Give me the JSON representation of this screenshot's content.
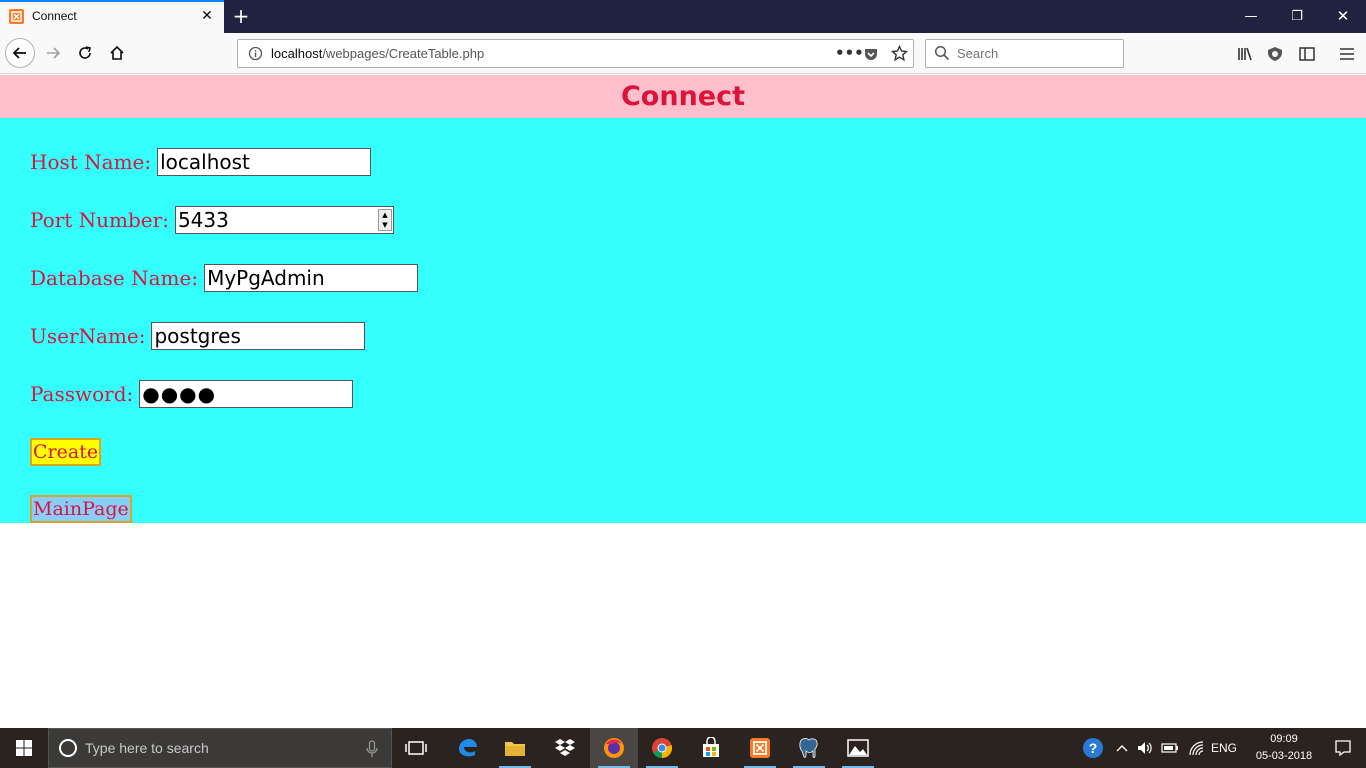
{
  "browser": {
    "tab_title": "Connect",
    "url_host": "localhost",
    "url_path": "/webpages/CreateTable.php",
    "search_placeholder": "Search"
  },
  "page": {
    "heading": "Connect",
    "fields": [
      {
        "label": "Host Name:",
        "value": "localhost"
      },
      {
        "label": "Port Number:",
        "value": "5433"
      },
      {
        "label": "Database Name:",
        "value": "MyPgAdmin"
      },
      {
        "label": "UserName:",
        "value": "postgres"
      },
      {
        "label": "Password:",
        "value": "●●●●"
      }
    ],
    "create_label": "Create",
    "mainpage_label": "MainPage"
  },
  "taskbar": {
    "search_placeholder": "Type here to search",
    "language": "ENG",
    "time": "09:09",
    "date": "05-03-2018"
  },
  "colors": {
    "header_bg": "#ffc0cb",
    "form_bg": "#33ffff",
    "label_color": "#dc143c",
    "create_bg": "#ffff00",
    "mainpage_bg": "#87cefa"
  }
}
